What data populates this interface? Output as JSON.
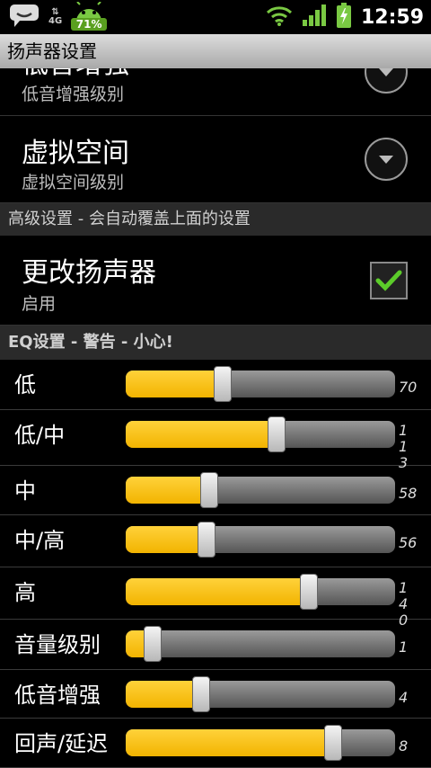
{
  "status_bar": {
    "battery_badge": "71%",
    "network": "4G",
    "time": "12:59"
  },
  "title": "扬声器设置",
  "prefs": [
    {
      "title": "低音增强",
      "summary": "低音增强级别"
    },
    {
      "title": "虚拟空间",
      "summary": "虚拟空间级别"
    }
  ],
  "advanced_header": "高级设置 - 会自动覆盖上面的设置",
  "change_speaker": {
    "title": "更改扬声器",
    "summary": "启用",
    "checked": true
  },
  "eq_header": "EQ设置 - 警告 - 小心!",
  "eq": [
    {
      "label": "低",
      "value": "70",
      "fill": 0.36
    },
    {
      "label": "低/中",
      "value": "113",
      "fill": 0.56
    },
    {
      "label": "中",
      "value": "58",
      "fill": 0.31
    },
    {
      "label": "中/高",
      "value": "56",
      "fill": 0.3
    },
    {
      "label": "高",
      "value": "140",
      "fill": 0.68
    },
    {
      "label": "音量级别",
      "value": "1",
      "fill": 0.1
    },
    {
      "label": "低音增强",
      "value": "4",
      "fill": 0.28
    },
    {
      "label": "回声/延迟",
      "value": "8",
      "fill": 0.77
    }
  ],
  "colors": {
    "fill": "#f2b400",
    "section_bg": "#2a2a2a",
    "check": "#5ccc2a"
  }
}
